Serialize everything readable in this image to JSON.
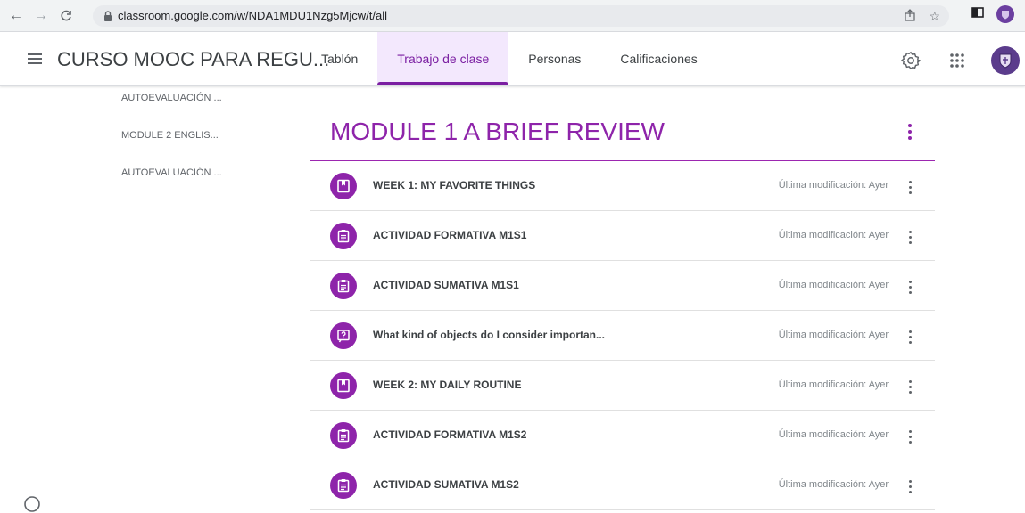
{
  "browser": {
    "url": "classroom.google.com/w/NDA1MDU1Nzg5Mjcw/t/all"
  },
  "header": {
    "class_title": "CURSO MOOC PARA REGU...",
    "tabs": [
      {
        "label": "Tablón"
      },
      {
        "label": "Trabajo de clase",
        "active": true
      },
      {
        "label": "Personas"
      },
      {
        "label": "Calificaciones"
      }
    ]
  },
  "sidebar": {
    "items": [
      {
        "label": "AUTOEVALUACIÓN ..."
      },
      {
        "label": "MODULE 2 ENGLIS..."
      },
      {
        "label": "AUTOEVALUACIÓN ..."
      }
    ]
  },
  "topic": {
    "title": "MODULE 1 A BRIEF REVIEW"
  },
  "items": [
    {
      "title": "WEEK 1: MY FAVORITE THINGS",
      "modified": "Última modificación: Ayer",
      "icon": "material-icon"
    },
    {
      "title": "ACTIVIDAD FORMATIVA M1S1",
      "modified": "Última modificación: Ayer",
      "icon": "assignment-icon"
    },
    {
      "title": "ACTIVIDAD SUMATIVA M1S1",
      "modified": "Última modificación: Ayer",
      "icon": "assignment-icon"
    },
    {
      "title": "What kind of objects do I consider importan...",
      "modified": "Última modificación: Ayer",
      "icon": "question-icon"
    },
    {
      "title": "WEEK 2: MY DAILY ROUTINE",
      "modified": "Última modificación: Ayer",
      "icon": "material-icon"
    },
    {
      "title": "ACTIVIDAD FORMATIVA M1S2",
      "modified": "Última modificación: Ayer",
      "icon": "assignment-icon"
    },
    {
      "title": "ACTIVIDAD SUMATIVA M1S2",
      "modified": "Última modificación: Ayer",
      "icon": "assignment-icon"
    }
  ],
  "colors": {
    "accent": "#8e24aa",
    "active_tab_bg": "#f3e8fd"
  }
}
